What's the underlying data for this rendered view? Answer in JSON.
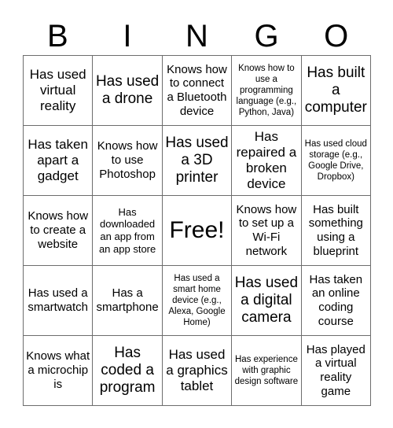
{
  "card": {
    "title": "BINGO",
    "header_letters": [
      "B",
      "I",
      "N",
      "G",
      "O"
    ],
    "grid_size": "5x5",
    "free_space_index": 12,
    "colors": {
      "text": "#000000",
      "grid_line": "#6d6d6d",
      "background": "#ffffff"
    },
    "cells": [
      {
        "text": "Has used virtual reality",
        "size": "lg"
      },
      {
        "text": "Has used a drone",
        "size": "xl"
      },
      {
        "text": "Knows how to connect a Bluetooth device",
        "size": "md"
      },
      {
        "text": "Knows how to use a programming language (e.g., Python, Java)",
        "size": "xs"
      },
      {
        "text": "Has built a computer",
        "size": "xl"
      },
      {
        "text": "Has taken apart a gadget",
        "size": "lg"
      },
      {
        "text": "Knows how to use Photoshop",
        "size": "md"
      },
      {
        "text": "Has used a 3D printer",
        "size": "xl"
      },
      {
        "text": "Has repaired a broken device",
        "size": "lg"
      },
      {
        "text": "Has used cloud storage (e.g., Google Drive, Dropbox)",
        "size": "xs"
      },
      {
        "text": "Knows how to create a website",
        "size": "md"
      },
      {
        "text": "Has downloaded an app from an app store",
        "size": "sm"
      },
      {
        "text": "Free!",
        "size": "xxl"
      },
      {
        "text": "Knows how to set up a Wi-Fi network",
        "size": "md"
      },
      {
        "text": "Has built something using a blueprint",
        "size": "md"
      },
      {
        "text": "Has used a smartwatch",
        "size": "md"
      },
      {
        "text": "Has a smartphone",
        "size": "md"
      },
      {
        "text": "Has used a smart home device (e.g., Alexa, Google Home)",
        "size": "xs"
      },
      {
        "text": "Has used a digital camera",
        "size": "xl"
      },
      {
        "text": "Has taken an online coding course",
        "size": "md"
      },
      {
        "text": "Knows what a microchip is",
        "size": "md"
      },
      {
        "text": "Has coded a program",
        "size": "xl"
      },
      {
        "text": "Has used a graphics tablet",
        "size": "lg"
      },
      {
        "text": "Has experience with graphic design software",
        "size": "xs"
      },
      {
        "text": "Has played a virtual reality game",
        "size": "md"
      }
    ]
  }
}
